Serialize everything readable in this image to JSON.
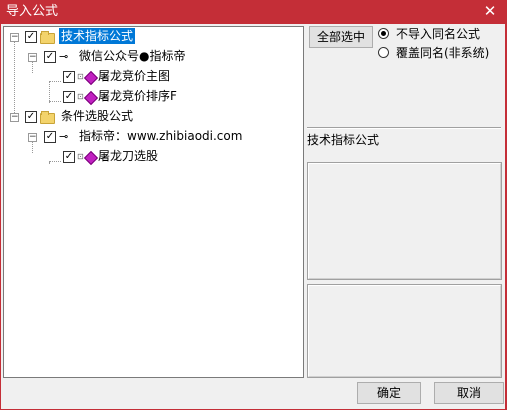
{
  "window": {
    "title": "导入公式",
    "close_glyph": "✕"
  },
  "tree": {
    "nodes": [
      {
        "label": "技术指标公式",
        "checked": true,
        "type": "folder",
        "selected": true
      },
      {
        "label": "微信公众号●指标帝",
        "checked": true,
        "type": "key"
      },
      {
        "label": "屠龙竞价主图",
        "checked": true,
        "type": "formula"
      },
      {
        "label": "屠龙竞价排序F",
        "checked": true,
        "type": "formula"
      },
      {
        "label": "条件选股公式",
        "checked": true,
        "type": "folder"
      },
      {
        "label": "指标帝：www.zhibiaodi.com",
        "checked": true,
        "type": "key"
      },
      {
        "label": "屠龙刀选股",
        "checked": true,
        "type": "formula"
      }
    ],
    "check_glyph": "✓",
    "expander_glyph": "−"
  },
  "right": {
    "select_all_label": "全部选中",
    "radio_options": [
      {
        "label": "不导入同名公式",
        "selected": true
      },
      {
        "label": "覆盖同名(非系统)",
        "selected": false
      }
    ],
    "section_title": "技术指标公式"
  },
  "footer": {
    "ok_label": "确定",
    "cancel_label": "取消"
  },
  "colors": {
    "title_bar": "#c42e37",
    "selection": "#0078d7"
  }
}
